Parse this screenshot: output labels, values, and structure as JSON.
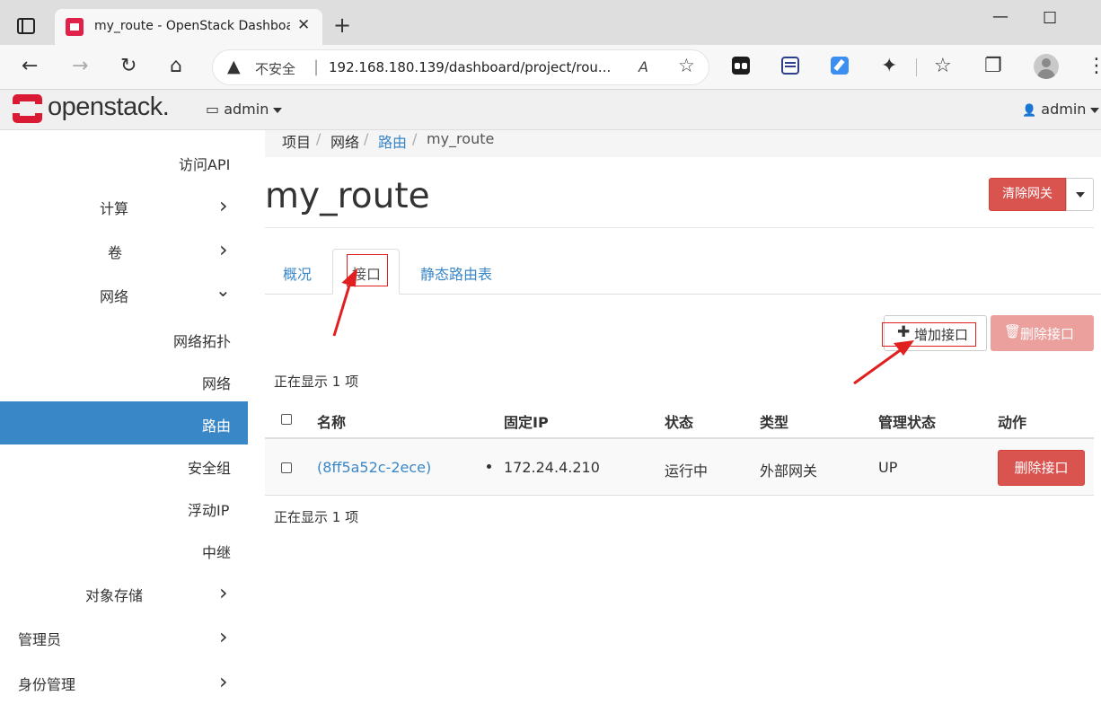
{
  "browser": {
    "tab_title": "my_route - OpenStack Dashboard",
    "close_glyph": "✕",
    "new_tab_glyph": "+",
    "security_label": "不安全",
    "address_separator": "|",
    "url": "192.168.180.139/dashboard/project/rou...",
    "read_aloud_glyph": "A",
    "favorites_glyph": "☆",
    "back_glyph": "←",
    "forward_glyph": "→",
    "refresh_glyph": "↻",
    "home_glyph": "⌂",
    "warning_glyph": "▲",
    "extensions_glyph": "✦",
    "collections_glyph": "☆",
    "copy_glyph": "❐",
    "more_glyph": "⋮",
    "minimize_glyph": "—",
    "maximize_glyph": "☐"
  },
  "header": {
    "logo_text": "openstack.",
    "project_label": "admin",
    "project_icon": "▭",
    "user_label": "admin",
    "user_icon": "👤"
  },
  "sidebar": {
    "chevron_right": "›",
    "chevron_down": "⌄",
    "items": [
      {
        "label": "访问API"
      },
      {
        "label": "计算"
      },
      {
        "label": "卷"
      },
      {
        "label": "网络"
      },
      {
        "label": "网络拓扑"
      },
      {
        "label": "网络"
      },
      {
        "label": "路由"
      },
      {
        "label": "安全组"
      },
      {
        "label": "浮动IP"
      },
      {
        "label": "中继"
      },
      {
        "label": "对象存储"
      },
      {
        "label": "管理员"
      },
      {
        "label": "身份管理"
      }
    ]
  },
  "breadcrumb": {
    "items": [
      "项目",
      "网络",
      "路由",
      "my_route"
    ],
    "separator": "/"
  },
  "page": {
    "title": "my_route",
    "clear_gateway_button": "清除网关"
  },
  "tabs": [
    {
      "label": "概况"
    },
    {
      "label": "接口"
    },
    {
      "label": "静态路由表"
    }
  ],
  "actions": {
    "add_interface": "增加接口",
    "add_glyph": "✚",
    "delete_interfaces": "删除接口",
    "trash_glyph": "🗑"
  },
  "table": {
    "count_top": "正在显示 1 项",
    "count_bottom": "正在显示 1 项",
    "columns": [
      "名称",
      "固定IP",
      "状态",
      "类型",
      "管理状态",
      "动作"
    ],
    "rows": [
      {
        "name": "(8ff5a52c-2ece)",
        "fixed_ip": "172.24.4.210",
        "status": "运行中",
        "type": "外部网关",
        "admin_state": "UP",
        "action": "删除接口"
      }
    ]
  },
  "colors": {
    "accent": "#3a87c8",
    "danger": "#d9534f",
    "annotation": "#e02020"
  }
}
